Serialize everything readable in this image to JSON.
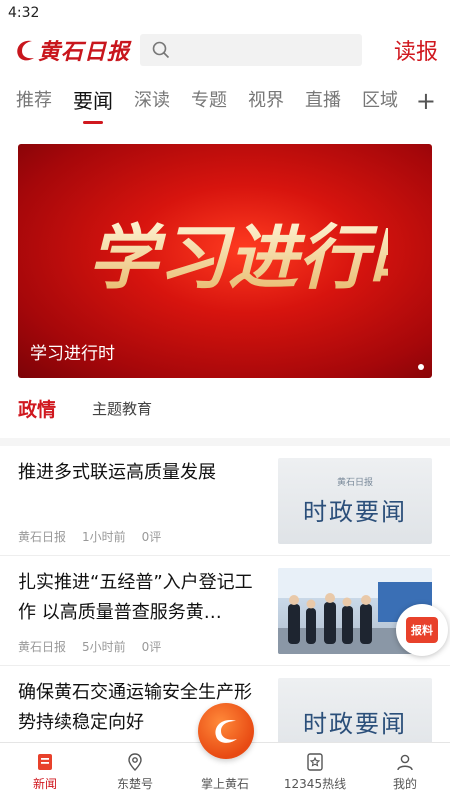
{
  "status": {
    "time": "4:32"
  },
  "header": {
    "logo_text": "黄石日报",
    "read_label": "读报"
  },
  "tabs": [
    {
      "label": "推荐"
    },
    {
      "label": "要闻"
    },
    {
      "label": "深读"
    },
    {
      "label": "专题"
    },
    {
      "label": "视界"
    },
    {
      "label": "直播"
    },
    {
      "label": "区域"
    }
  ],
  "banner": {
    "art_text": "学习进行时",
    "caption": "学习进行时"
  },
  "section_tabs": [
    {
      "label": "政情"
    },
    {
      "label": "主题教育"
    }
  ],
  "news": [
    {
      "title": "推进多式联运高质量发展",
      "source": "黄石日报",
      "time": "1小时前",
      "comments": "0评",
      "thumb_brand": "黄石日报",
      "thumb_text": "时政要闻"
    },
    {
      "title": "扎实推进“五经普”入户登记工作 以高质量普查服务黄…",
      "source": "黄石日报",
      "time": "5小时前",
      "comments": "0评"
    },
    {
      "title": "确保黄石交通运输安全生产形势持续稳定向好",
      "thumb_text": "时政要闻"
    }
  ],
  "report_fab": {
    "label": "报料"
  },
  "bottom_nav": [
    {
      "label": "新闻"
    },
    {
      "label": "东楚号"
    },
    {
      "label": "掌上黄石"
    },
    {
      "label": "12345热线"
    },
    {
      "label": "我的"
    }
  ],
  "colors": {
    "brand_red": "#d0181f",
    "fab_orange": "#e84a13"
  }
}
